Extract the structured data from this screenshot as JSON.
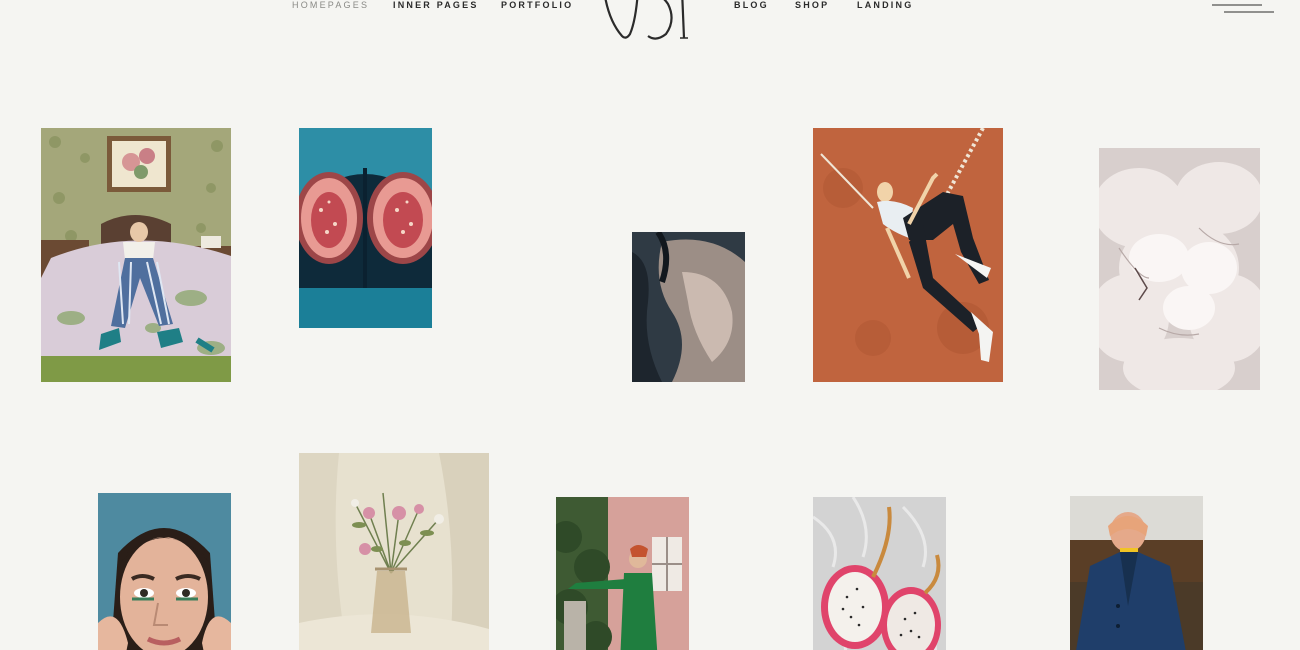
{
  "nav": {
    "items": [
      {
        "label": "HOMEPAGES",
        "active": true
      },
      {
        "label": "INNER PAGES",
        "active": false
      },
      {
        "label": "PORTFOLIO",
        "active": false
      },
      {
        "label": "BLOG",
        "active": false
      },
      {
        "label": "SHOP",
        "active": false
      },
      {
        "label": "LANDING",
        "active": false
      }
    ],
    "logo_icon": "monogram-logo",
    "menu_icon": "hamburger-menu-icon"
  },
  "gallery": {
    "photos": [
      {
        "subject": "woman-lying-on-bed"
      },
      {
        "subject": "halved-figs"
      },
      {
        "subject": "painting-detail"
      },
      {
        "subject": "man-on-orange-wall"
      },
      {
        "subject": "white-peony"
      },
      {
        "subject": "woman-portrait"
      },
      {
        "subject": "flowers-in-vase"
      },
      {
        "subject": "woman-in-green"
      },
      {
        "subject": "dragon-fruit"
      },
      {
        "subject": "person-in-blue-coat"
      }
    ]
  },
  "colors": {
    "background": "#f5f5f2",
    "text": "#2b2b2b",
    "active_nav": "#8a8a86"
  }
}
